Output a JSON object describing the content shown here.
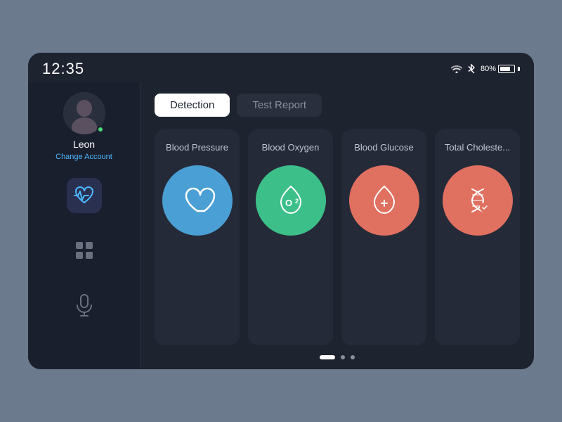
{
  "statusBar": {
    "time": "12:35",
    "battery": "80%",
    "batteryLevel": 80
  },
  "sidebar": {
    "user": {
      "name": "Leon",
      "changeAccountLabel": "Change Account",
      "online": true
    },
    "navItems": [
      {
        "id": "health-monitor",
        "icon": "heartbeat",
        "active": true
      },
      {
        "id": "apps",
        "icon": "grid",
        "active": false
      },
      {
        "id": "microphone",
        "icon": "mic",
        "active": false
      }
    ]
  },
  "tabs": [
    {
      "id": "detection",
      "label": "Detection",
      "active": true
    },
    {
      "id": "test-report",
      "label": "Test Report",
      "active": false
    }
  ],
  "cards": [
    {
      "id": "blood-pressure",
      "title": "Blood Pressure",
      "color": "blue",
      "icon": "heart"
    },
    {
      "id": "blood-oxygen",
      "title": "Blood Oxygen",
      "color": "green",
      "icon": "o2"
    },
    {
      "id": "blood-glucose",
      "title": "Blood Glucose",
      "color": "coral",
      "icon": "drop-plus"
    },
    {
      "id": "total-cholesterol",
      "title": "Total Choleste...",
      "color": "red-orange",
      "icon": "dna"
    }
  ],
  "pagination": {
    "dots": [
      {
        "active": true
      },
      {
        "active": false
      },
      {
        "active": false
      }
    ]
  }
}
